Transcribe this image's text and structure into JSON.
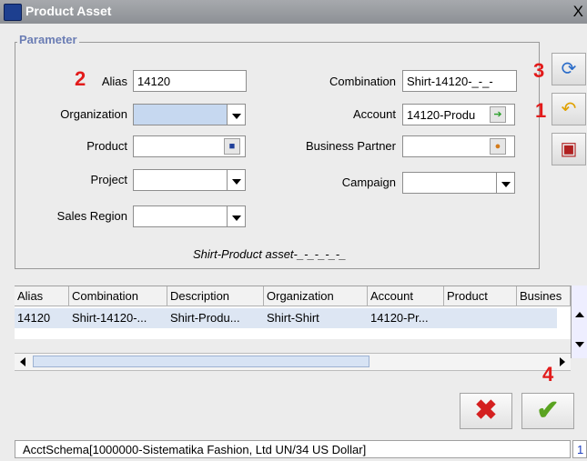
{
  "window": {
    "title": "Product Asset",
    "close_glyph": "X"
  },
  "parameter": {
    "legend": "Parameter",
    "alias": {
      "label": "Alias",
      "value": "14120"
    },
    "organization": {
      "label": "Organization",
      "value": ""
    },
    "product": {
      "label": "Product",
      "value": ""
    },
    "project": {
      "label": "Project",
      "value": ""
    },
    "sales_region": {
      "label": "Sales Region",
      "value": ""
    },
    "combination": {
      "label": "Combination",
      "value": "Shirt-14120-_-_-"
    },
    "account": {
      "label": "Account",
      "value": "14120-Produ"
    },
    "business_partner": {
      "label": "Business Partner",
      "value": ""
    },
    "campaign": {
      "label": "Campaign",
      "value": ""
    },
    "description": "Shirt-Product asset-_-_-_-_-_"
  },
  "annotations": {
    "n1": "1",
    "n2": "2",
    "n3": "3",
    "n4": "4"
  },
  "table": {
    "headers": [
      "Alias",
      "Combination",
      "Description",
      "Organization",
      "Account",
      "Product",
      "Busines"
    ],
    "rows": [
      [
        "14120",
        "Shirt-14120-...",
        "Shirt-Produ...",
        "Shirt-Shirt",
        "14120-Pr...",
        "",
        ""
      ]
    ]
  },
  "status": {
    "text": "AcctSchema[1000000-Sistematika Fashion, Ltd UN/34 US Dollar]",
    "right": "1"
  },
  "icons": {
    "refresh": "refresh-icon",
    "undo": "undo-icon",
    "save": "save-icon",
    "cancel": "cancel-icon",
    "ok": "ok-icon"
  }
}
